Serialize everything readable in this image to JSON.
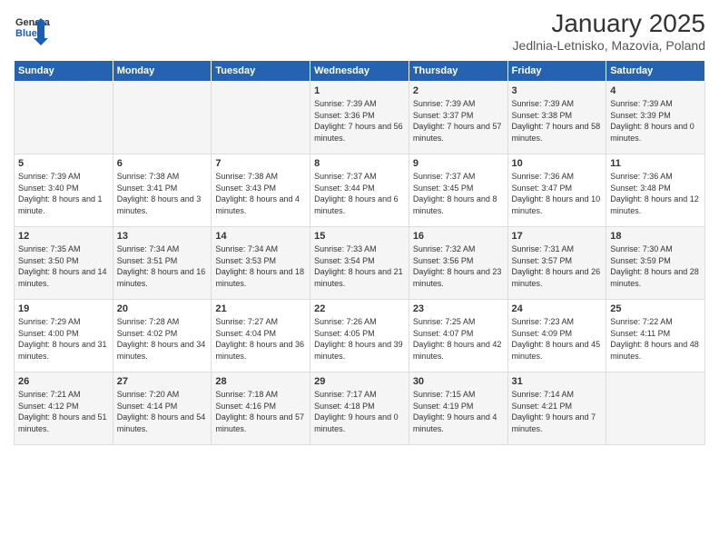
{
  "logo": {
    "general": "General",
    "blue": "Blue"
  },
  "title": "January 2025",
  "subtitle": "Jedlnia-Letnisko, Mazovia, Poland",
  "headers": [
    "Sunday",
    "Monday",
    "Tuesday",
    "Wednesday",
    "Thursday",
    "Friday",
    "Saturday"
  ],
  "weeks": [
    [
      {
        "num": "",
        "info": ""
      },
      {
        "num": "",
        "info": ""
      },
      {
        "num": "",
        "info": ""
      },
      {
        "num": "1",
        "info": "Sunrise: 7:39 AM\nSunset: 3:36 PM\nDaylight: 7 hours and 56 minutes."
      },
      {
        "num": "2",
        "info": "Sunrise: 7:39 AM\nSunset: 3:37 PM\nDaylight: 7 hours and 57 minutes."
      },
      {
        "num": "3",
        "info": "Sunrise: 7:39 AM\nSunset: 3:38 PM\nDaylight: 7 hours and 58 minutes."
      },
      {
        "num": "4",
        "info": "Sunrise: 7:39 AM\nSunset: 3:39 PM\nDaylight: 8 hours and 0 minutes."
      }
    ],
    [
      {
        "num": "5",
        "info": "Sunrise: 7:39 AM\nSunset: 3:40 PM\nDaylight: 8 hours and 1 minute."
      },
      {
        "num": "6",
        "info": "Sunrise: 7:38 AM\nSunset: 3:41 PM\nDaylight: 8 hours and 3 minutes."
      },
      {
        "num": "7",
        "info": "Sunrise: 7:38 AM\nSunset: 3:43 PM\nDaylight: 8 hours and 4 minutes."
      },
      {
        "num": "8",
        "info": "Sunrise: 7:37 AM\nSunset: 3:44 PM\nDaylight: 8 hours and 6 minutes."
      },
      {
        "num": "9",
        "info": "Sunrise: 7:37 AM\nSunset: 3:45 PM\nDaylight: 8 hours and 8 minutes."
      },
      {
        "num": "10",
        "info": "Sunrise: 7:36 AM\nSunset: 3:47 PM\nDaylight: 8 hours and 10 minutes."
      },
      {
        "num": "11",
        "info": "Sunrise: 7:36 AM\nSunset: 3:48 PM\nDaylight: 8 hours and 12 minutes."
      }
    ],
    [
      {
        "num": "12",
        "info": "Sunrise: 7:35 AM\nSunset: 3:50 PM\nDaylight: 8 hours and 14 minutes."
      },
      {
        "num": "13",
        "info": "Sunrise: 7:34 AM\nSunset: 3:51 PM\nDaylight: 8 hours and 16 minutes."
      },
      {
        "num": "14",
        "info": "Sunrise: 7:34 AM\nSunset: 3:53 PM\nDaylight: 8 hours and 18 minutes."
      },
      {
        "num": "15",
        "info": "Sunrise: 7:33 AM\nSunset: 3:54 PM\nDaylight: 8 hours and 21 minutes."
      },
      {
        "num": "16",
        "info": "Sunrise: 7:32 AM\nSunset: 3:56 PM\nDaylight: 8 hours and 23 minutes."
      },
      {
        "num": "17",
        "info": "Sunrise: 7:31 AM\nSunset: 3:57 PM\nDaylight: 8 hours and 26 minutes."
      },
      {
        "num": "18",
        "info": "Sunrise: 7:30 AM\nSunset: 3:59 PM\nDaylight: 8 hours and 28 minutes."
      }
    ],
    [
      {
        "num": "19",
        "info": "Sunrise: 7:29 AM\nSunset: 4:00 PM\nDaylight: 8 hours and 31 minutes."
      },
      {
        "num": "20",
        "info": "Sunrise: 7:28 AM\nSunset: 4:02 PM\nDaylight: 8 hours and 34 minutes."
      },
      {
        "num": "21",
        "info": "Sunrise: 7:27 AM\nSunset: 4:04 PM\nDaylight: 8 hours and 36 minutes."
      },
      {
        "num": "22",
        "info": "Sunrise: 7:26 AM\nSunset: 4:05 PM\nDaylight: 8 hours and 39 minutes."
      },
      {
        "num": "23",
        "info": "Sunrise: 7:25 AM\nSunset: 4:07 PM\nDaylight: 8 hours and 42 minutes."
      },
      {
        "num": "24",
        "info": "Sunrise: 7:23 AM\nSunset: 4:09 PM\nDaylight: 8 hours and 45 minutes."
      },
      {
        "num": "25",
        "info": "Sunrise: 7:22 AM\nSunset: 4:11 PM\nDaylight: 8 hours and 48 minutes."
      }
    ],
    [
      {
        "num": "26",
        "info": "Sunrise: 7:21 AM\nSunset: 4:12 PM\nDaylight: 8 hours and 51 minutes."
      },
      {
        "num": "27",
        "info": "Sunrise: 7:20 AM\nSunset: 4:14 PM\nDaylight: 8 hours and 54 minutes."
      },
      {
        "num": "28",
        "info": "Sunrise: 7:18 AM\nSunset: 4:16 PM\nDaylight: 8 hours and 57 minutes."
      },
      {
        "num": "29",
        "info": "Sunrise: 7:17 AM\nSunset: 4:18 PM\nDaylight: 9 hours and 0 minutes."
      },
      {
        "num": "30",
        "info": "Sunrise: 7:15 AM\nSunset: 4:19 PM\nDaylight: 9 hours and 4 minutes."
      },
      {
        "num": "31",
        "info": "Sunrise: 7:14 AM\nSunset: 4:21 PM\nDaylight: 9 hours and 7 minutes."
      },
      {
        "num": "",
        "info": ""
      }
    ]
  ]
}
